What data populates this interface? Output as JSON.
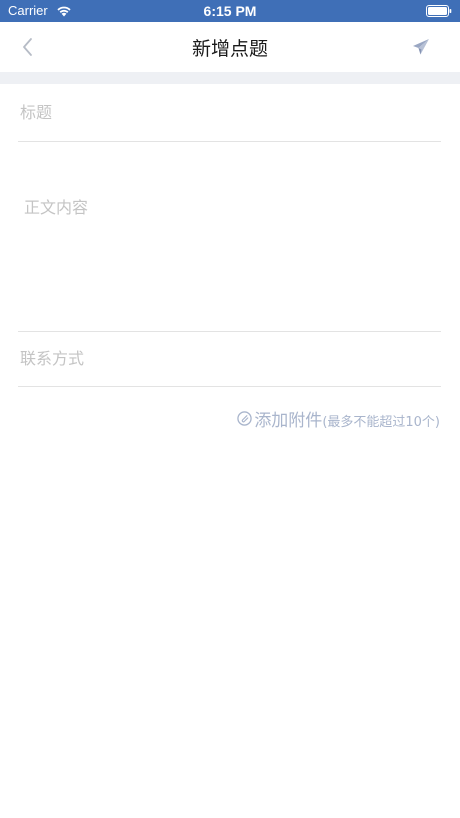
{
  "status_bar": {
    "carrier": "Carrier",
    "time": "6:15 PM"
  },
  "nav": {
    "title": "新增点题"
  },
  "form": {
    "title_placeholder": "标题",
    "content_placeholder": "正文内容",
    "contact_placeholder": "联系方式"
  },
  "attachment": {
    "label": "添加附件",
    "note": "(最多不能超过10个)"
  },
  "colors": {
    "status_bar": "#3f6fb7",
    "accent": "#a9b5cc",
    "placeholder": "#c4c4c4"
  }
}
